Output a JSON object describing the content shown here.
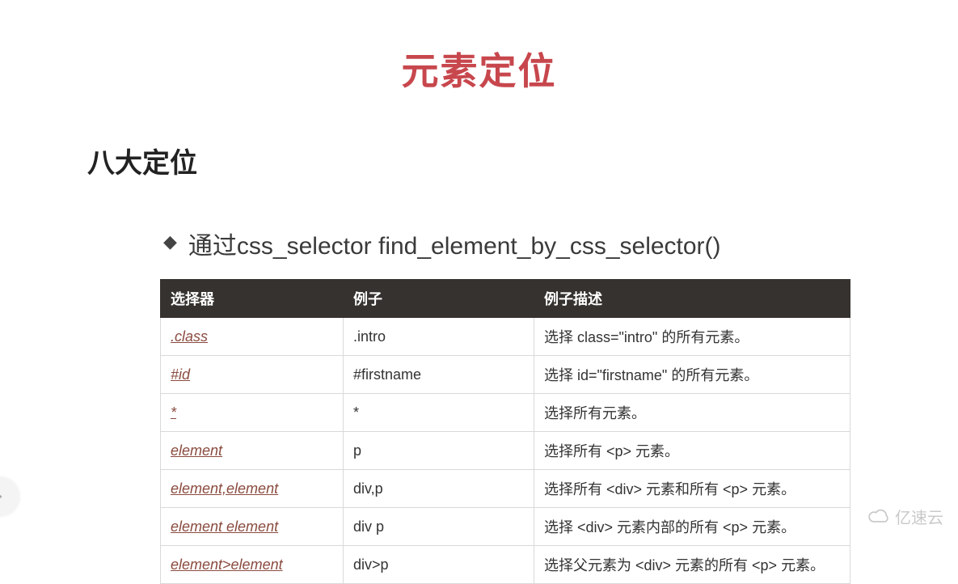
{
  "title": "元素定位",
  "section": "八大定位",
  "bullet": "通过css_selector  find_element_by_css_selector()",
  "table": {
    "headers": [
      "选择器",
      "例子",
      "例子描述"
    ],
    "rows": [
      {
        "selector": ".class",
        "example": ".intro",
        "desc": "选择 class=\"intro\" 的所有元素。"
      },
      {
        "selector": "#id",
        "example": "#firstname",
        "desc": "选择 id=\"firstname\" 的所有元素。"
      },
      {
        "selector": "*",
        "example": "*",
        "desc": "选择所有元素。"
      },
      {
        "selector": "element",
        "example": "p",
        "desc": "选择所有 <p> 元素。"
      },
      {
        "selector": "element,element",
        "example": "div,p",
        "desc": "选择所有 <div> 元素和所有 <p> 元素。"
      },
      {
        "selector": "element element",
        "example": "div p",
        "desc": "选择 <div> 元素内部的所有 <p> 元素。"
      },
      {
        "selector": "element>element",
        "example": "div>p",
        "desc": "选择父元素为 <div> 元素的所有 <p> 元素。"
      }
    ]
  },
  "watermark": "亿速云"
}
